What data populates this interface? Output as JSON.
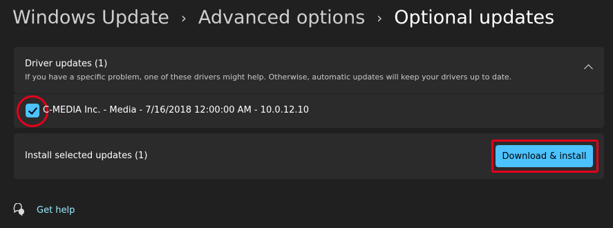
{
  "breadcrumb": {
    "items": [
      "Windows Update",
      "Advanced options"
    ],
    "separator": "›",
    "current": "Optional updates"
  },
  "driver_section": {
    "title": "Driver updates (1)",
    "description": "If you have a specific problem, one of these drivers might help. Otherwise, automatic updates will keep your drivers up to date.",
    "expanded": true
  },
  "drivers": [
    {
      "label": "C-MEDIA Inc. - Media - 7/16/2018 12:00:00 AM - 10.0.12.10",
      "checked": true
    }
  ],
  "install": {
    "label": "Install selected updates (1)",
    "button": "Download & install"
  },
  "help": {
    "label": "Get help"
  },
  "colors": {
    "background": "#202020",
    "card": "#2b2b2b",
    "accent": "#4cc2ff",
    "annotation": "#e6001a",
    "link": "#99ebff"
  }
}
